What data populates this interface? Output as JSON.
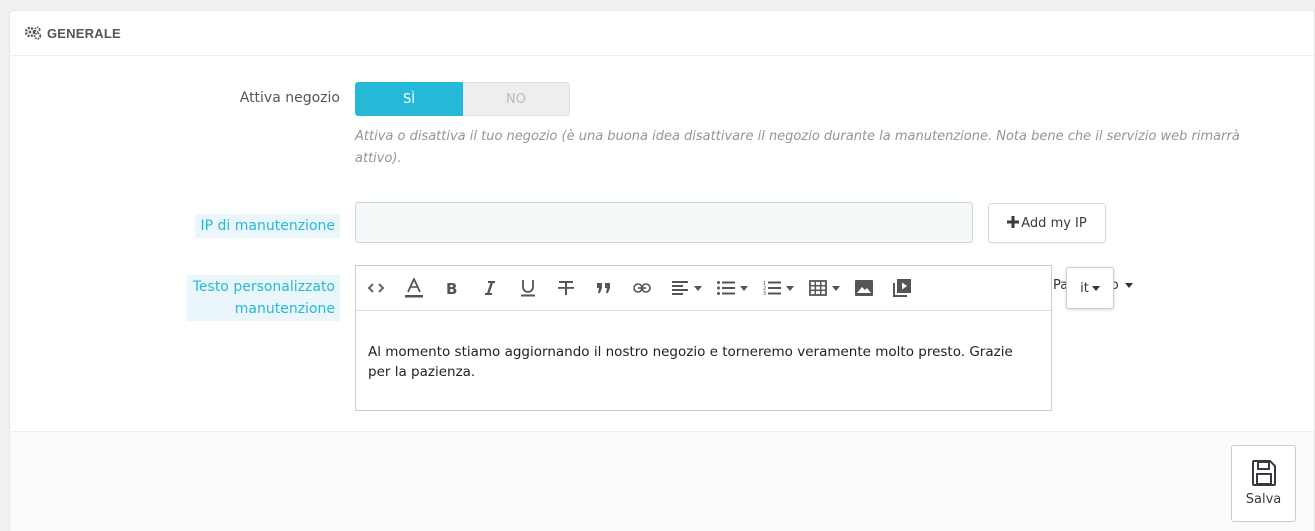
{
  "panel": {
    "title": "GENERALE"
  },
  "shop_enable": {
    "label": "Attiva negozio",
    "on_label": "SÌ",
    "off_label": "NO",
    "selected": "SÌ",
    "help": "Attiva o disattiva il tuo negozio (è una buona idea disattivare il negozio durante la manutenzione. Nota bene che il servizio web rimarrà attivo)."
  },
  "maintenance_ip": {
    "label": "IP di manutenzione",
    "value": "",
    "add_button_label": "Add my IP"
  },
  "custom_text": {
    "label_line1": "Testo personalizzato",
    "label_line2": "manutenzione",
    "content": "Al momento stiamo aggiornando il nostro negozio e torneremo veramente molto presto. Grazie per la pazienza.",
    "paragraph_prefix": "Pa",
    "paragraph_suffix": "fo",
    "language": "it"
  },
  "toolbar_icons": [
    "code-icon",
    "font-color-icon",
    "bold-icon",
    "italic-icon",
    "underline-icon",
    "strikethrough-icon",
    "blockquote-icon",
    "link-icon",
    "align-icon",
    "bullet-list-icon",
    "numbered-list-icon",
    "table-icon",
    "image-icon",
    "media-icon"
  ],
  "footer": {
    "save_label": "Salva"
  },
  "colors": {
    "accent": "#25b9d7",
    "toggle_off": "#eeeeee",
    "help_text": "#959595"
  }
}
